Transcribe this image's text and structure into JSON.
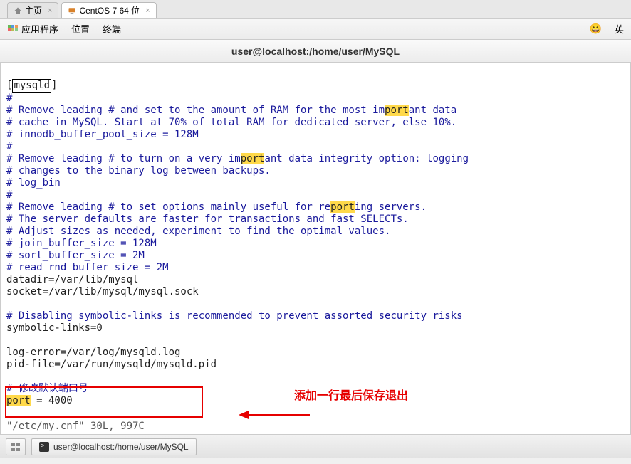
{
  "tabs": {
    "home_label": "主页",
    "vm_label": "CentOS 7 64 位"
  },
  "menu": {
    "applications": "应用程序",
    "places": "位置",
    "terminal": "终端",
    "lang": "英"
  },
  "title": "user@localhost:/home/user/MySQL",
  "editor": {
    "section_open": "[",
    "section_name": "mysqld",
    "section_close": "]",
    "l1": "#",
    "l2a": "# Remove leading # and set to the amount of RAM for the most im",
    "l2b": "port",
    "l2c": "ant data",
    "l3": "# cache in MySQL. Start at 70% of total RAM for dedicated server, else 10%.",
    "l4": "# innodb_buffer_pool_size = 128M",
    "l5": "#",
    "l6a": "# Remove leading # to turn on a very im",
    "l6b": "port",
    "l6c": "ant data integrity option: logging",
    "l7": "# changes to the binary log between backups.",
    "l8": "# log_bin",
    "l9": "#",
    "l10a": "# Remove leading # to set options mainly useful for re",
    "l10b": "port",
    "l10c": "ing servers.",
    "l11": "# The server defaults are faster for transactions and fast SELECTs.",
    "l12": "# Adjust sizes as needed, experiment to find the optimal values.",
    "l13": "# join_buffer_size = 128M",
    "l14": "# sort_buffer_size = 2M",
    "l15": "# read_rnd_buffer_size = 2M",
    "l16": "datadir=/var/lib/mysql",
    "l17": "socket=/var/lib/mysql/mysql.sock",
    "l18": "",
    "l19": "# Disabling symbolic-links is recommended to prevent assorted security risks",
    "l20": "symbolic-links=0",
    "l21": "",
    "l22": "log-error=/var/log/mysqld.log",
    "l23": "pid-file=/var/run/mysqld/mysqld.pid",
    "l24": "",
    "l25": "# 修改默认端口号",
    "l26a": "port",
    "l26b": " = 4000",
    "status": "\"/etc/my.cnf\" 30L, 997C"
  },
  "annotation": "添加一行最后保存退出",
  "taskbar": {
    "terminal_task": "user@localhost:/home/user/MySQL"
  }
}
